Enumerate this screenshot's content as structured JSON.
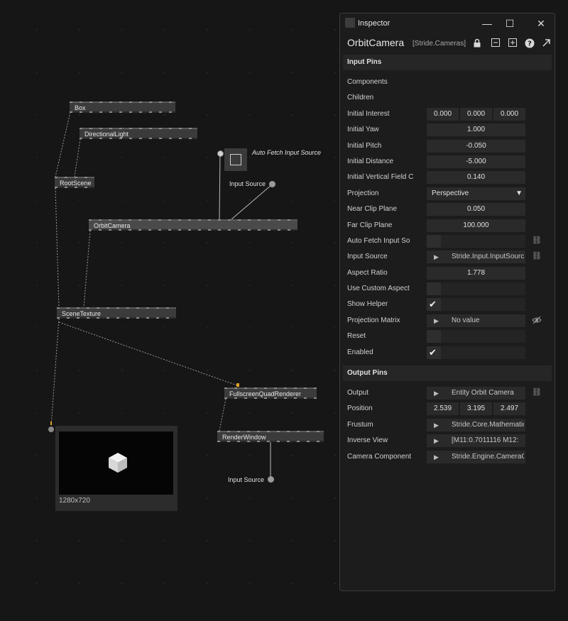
{
  "graph": {
    "nodes": {
      "box": "Box",
      "directional_light": "DirectionalLight",
      "root_scene": "RootScene",
      "orbit_camera": "OrbitCamera",
      "scene_texture": "SceneTexture",
      "fullscreen_quad_renderer": "FullscreenQuadRenderer",
      "render_window": "RenderWindow"
    },
    "labels": {
      "auto_fetch_input_source": "Auto Fetch Input Source",
      "input_source_1": "Input Source",
      "input_source_2": "Input Source"
    },
    "preview_resolution": "1280x720"
  },
  "inspector": {
    "window_title": "Inspector",
    "node_name": "OrbitCamera",
    "node_category": "[Stride.Cameras]",
    "input_pins_title": "Input Pins",
    "output_pins_title": "Output Pins",
    "input_pins": [
      {
        "label": "Components"
      },
      {
        "label": "Children"
      },
      {
        "label": "Initial Interest",
        "values": [
          "0.000",
          "0.000",
          "0.000"
        ]
      },
      {
        "label": "Initial Yaw",
        "value": "1.000"
      },
      {
        "label": "Initial Pitch",
        "value": "-0.050"
      },
      {
        "label": "Initial Distance",
        "value": "-5.000"
      },
      {
        "label": "Initial Vertical Field C",
        "value": "0.140"
      },
      {
        "label": "Projection",
        "value": "Perspective"
      },
      {
        "label": "Near Clip Plane",
        "value": "0.050"
      },
      {
        "label": "Far Clip Plane",
        "value": "100.000"
      },
      {
        "label": "Auto Fetch Input So"
      },
      {
        "label": "Input Source",
        "value": "Stride.Input.InputSource"
      },
      {
        "label": "Aspect Ratio",
        "value": "1.778"
      },
      {
        "label": "Use Custom Aspect"
      },
      {
        "label": "Show Helper",
        "checked": true
      },
      {
        "label": "Projection Matrix",
        "value": "No value"
      },
      {
        "label": "Reset"
      },
      {
        "label": "Enabled",
        "checked": true
      }
    ],
    "output_pins": [
      {
        "label": "Output",
        "value": "Entity Orbit Camera"
      },
      {
        "label": "Position",
        "values": [
          "2.539",
          "3.195",
          "2.497"
        ]
      },
      {
        "label": "Frustum",
        "value": "Stride.Core.Mathematics"
      },
      {
        "label": "Inverse View",
        "value": "[M11:0.7011116 M12:"
      },
      {
        "label": "Camera Component",
        "value": "Stride.Engine.CameraComponent"
      }
    ]
  },
  "colors": {
    "background": "#161616",
    "panel": "#1c1c1c",
    "node": "#3b3b3b",
    "accent_pin": "#e0a020"
  }
}
